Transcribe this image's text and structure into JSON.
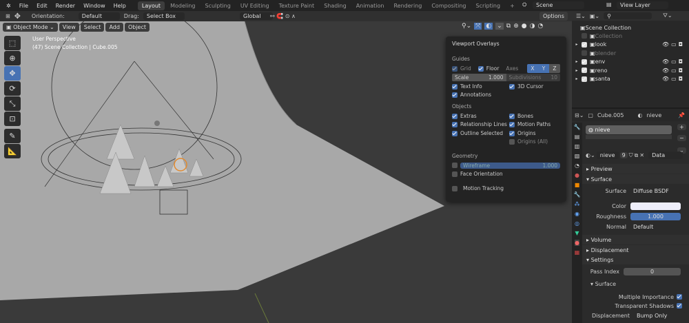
{
  "topbar": {
    "menus": [
      "File",
      "Edit",
      "Render",
      "Window",
      "Help"
    ],
    "workspaces": [
      "Layout",
      "Modeling",
      "Sculpting",
      "UV Editing",
      "Texture Paint",
      "Shading",
      "Animation",
      "Rendering",
      "Compositing",
      "Scripting"
    ],
    "add_tab": "+",
    "scene": "Scene",
    "view_layer": "View Layer"
  },
  "toolheader": {
    "orientation_label": "Orientation:",
    "orientation": "Default",
    "drag_label": "Drag:",
    "drag": "Select Box",
    "transform": "Global",
    "options": "Options"
  },
  "viewport": {
    "mode": "Object Mode",
    "menus": [
      "View",
      "Select",
      "Add",
      "Object"
    ],
    "info1": "User Perspective",
    "info2": "(47) Scene Collection | Cube.005"
  },
  "overlays": {
    "title": "Viewport Overlays",
    "guides": "Guides",
    "grid": "Grid",
    "floor": "Floor",
    "axes": "Axes",
    "x": "X",
    "y": "Y",
    "z": "Z",
    "scale_label": "Scale",
    "scale": "1.000",
    "subdiv_label": "Subdivisions",
    "subdiv": "10",
    "text_info": "Text Info",
    "cursor": "3D Cursor",
    "annotations": "Annotations",
    "objects": "Objects",
    "extras": "Extras",
    "bones": "Bones",
    "rel_lines": "Relationship Lines",
    "motion_paths": "Motion Paths",
    "outline_selected": "Outline Selected",
    "origins": "Origins",
    "origins_all": "Origins (All)",
    "geometry": "Geometry",
    "wireframe": "Wireframe",
    "wireframe_val": "1.000",
    "face_orientation": "Face Orientation",
    "motion_tracking": "Motion Tracking"
  },
  "outliner": {
    "root": "Scene Collection",
    "items": [
      {
        "name": "Collection",
        "enabled": false
      },
      {
        "name": "look",
        "enabled": true
      },
      {
        "name": "blender",
        "enabled": false
      },
      {
        "name": "env",
        "enabled": true
      },
      {
        "name": "reno",
        "enabled": true
      },
      {
        "name": "santa",
        "enabled": true
      }
    ]
  },
  "properties": {
    "object": "Cube.005",
    "material": "nieve",
    "slot": "nieve",
    "mat_name": "nieve",
    "users": "9",
    "link": "Data",
    "preview": "Preview",
    "surface_panel": "Surface",
    "surface_label": "Surface",
    "surface": "Diffuse BSDF",
    "color_label": "Color",
    "color": "#eeeefa",
    "roughness_label": "Roughness",
    "roughness": "1.000",
    "normal_label": "Normal",
    "normal": "Default",
    "volume": "Volume",
    "displacement_panel": "Displacement",
    "settings": "Settings",
    "pass_index_label": "Pass Index",
    "pass_index": "0",
    "surface_sub": "Surface",
    "mult_imp": "Multiple Importance",
    "transp_shadows": "Transparent Shadows",
    "displacement_label": "Displacement",
    "displacement": "Bump Only"
  },
  "colors": {
    "accent": "#4772b3",
    "plane": "#a9a9a9",
    "floor": "#3a3a3a"
  }
}
